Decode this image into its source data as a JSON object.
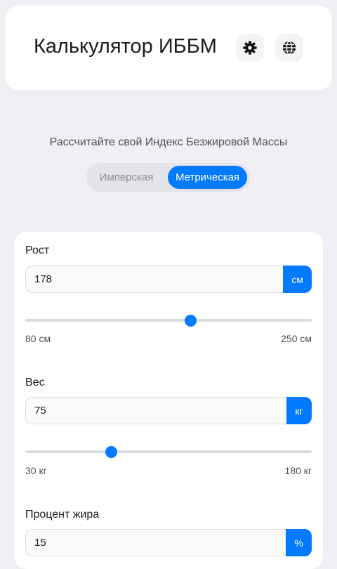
{
  "header": {
    "title": "Калькулятор ИББМ",
    "settings_icon": "gear-icon",
    "language_icon": "globe-icon"
  },
  "subtitle": "Рассчитайте свой Индекс Безжировой Массы",
  "unit_toggle": {
    "imperial": "Имперская",
    "metric": "Метрическая",
    "selected": "metric"
  },
  "height": {
    "label": "Рост",
    "value": "178",
    "unit": "см",
    "min": 80,
    "max": 250,
    "min_label": "80 см",
    "max_label": "250 см"
  },
  "weight": {
    "label": "Вес",
    "value": "75",
    "unit": "кг",
    "min": 30,
    "max": 180,
    "min_label": "30 кг",
    "max_label": "180 кг"
  },
  "body_fat": {
    "label": "Процент жира",
    "value": "15",
    "unit": "%"
  },
  "colors": {
    "accent": "#007aff",
    "background": "#efeff4",
    "card": "#ffffff"
  }
}
